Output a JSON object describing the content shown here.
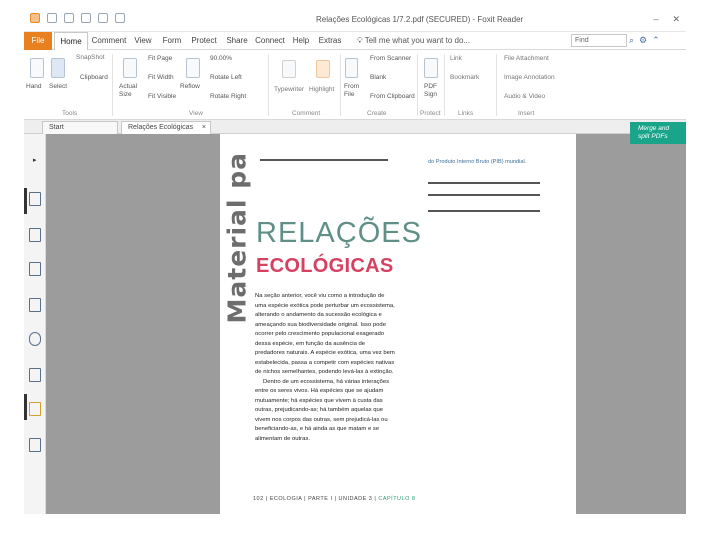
{
  "window": {
    "title": "Relações Ecológicas 1/7.2.pdf (SECURED) - Foxit Reader",
    "min": "–",
    "close": "✕"
  },
  "menu": {
    "tabs": [
      "File",
      "Home",
      "Comment",
      "View",
      "Form",
      "Protect",
      "Share",
      "Connect",
      "Help",
      "Extras"
    ],
    "tell_me": "Tell me what you want to do...",
    "find_placeholder": "Find"
  },
  "ribbon": {
    "tools": {
      "hand": "Hand",
      "select": "Select",
      "group": "Tools"
    },
    "view": {
      "snapshot": "SnapShot",
      "clipboard": "Clipboard",
      "actual_size": "Actual Size",
      "fit_page": "Fit Page",
      "fit_width": "Fit Width",
      "fit_visible": "Fit Visible",
      "reflow": "Reflow",
      "zoom": "90.00%",
      "rotate_left": "Rotate Left",
      "rotate_right": "Rotate Right",
      "group": "View"
    },
    "comment": {
      "typewriter": "Typewriter",
      "highlight": "Highlight",
      "group": "Comment"
    },
    "create": {
      "from_file": "From File",
      "from_scanner": "From Scanner",
      "blank": "Blank",
      "from_clipboard": "From Clipboard",
      "group": "Create"
    },
    "protect": {
      "pdf_sign": "PDF Sign",
      "group": "Protect"
    },
    "links": {
      "link": "Link",
      "bookmark": "Bookmark",
      "group": "Links"
    },
    "insert": {
      "file_attachment": "File Attachment",
      "image_annotation": "Image Annotation",
      "audio_video": "Audio & Video",
      "group": "Insert"
    }
  },
  "doc_tabs": [
    {
      "label": "Start"
    },
    {
      "label": "Relações Ecológicas 1/7..."
    }
  ],
  "merge": {
    "line1": "Merge and",
    "line2": "split PDFs"
  },
  "document": {
    "watermark": "Material pa",
    "credit": "do Produto Interno Bruto (PIB) mundial.",
    "title_line1": "RELAÇÕES",
    "title_line2": "ECOLÓGICAS",
    "paragraph1": "Na seção anterior, você viu como a introdução de uma espécie exótica pode perturbar um ecossistema, alterando o andamento da sucessão ecológica e ameaçando sua biodiversidade original. Isso pode ocorrer pelo crescimento populacional exagerado dessa espécie, em função da ausência de predadores naturais. A espécie exótica, uma vez bem estabelecida, passa a competir com espécies nativas de nichos semelhantes, podendo levá-las à extinção.",
    "paragraph2": "Dentro de um ecossistema, há várias interações entre os seres vivos. Há espécies que se ajudam mutuamente; há espécies que vivem à custa das outras, prejudicando-as; há também aquelas que vivem nos corpos das outras, sem prejudicá-las ou beneficiando-as, e há ainda as que matam e se alimentam de outras.",
    "footer_page": "102",
    "footer_a": "ECOLOGIA",
    "footer_b": "PARTE I",
    "footer_c": "UNIDADE 3",
    "footer_d": "CAPÍTULO 8"
  }
}
